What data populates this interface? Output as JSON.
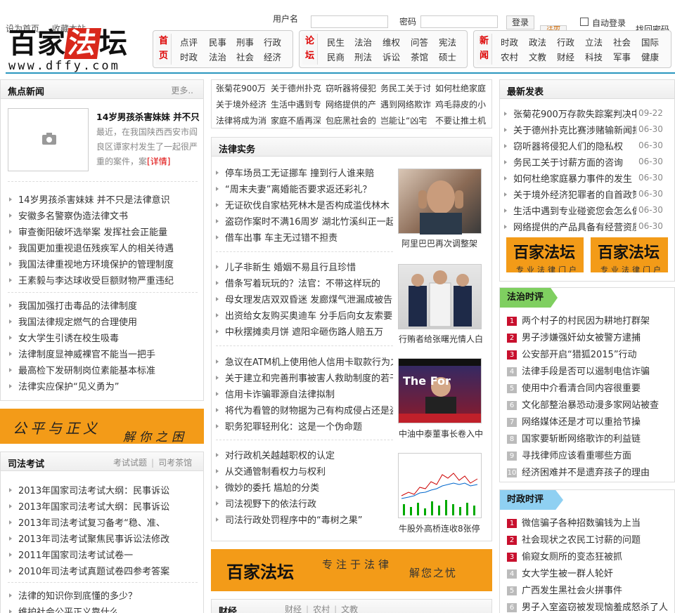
{
  "header": {
    "top_links": [
      "设为首页",
      "收藏本站"
    ],
    "login": {
      "username_label": "用户名",
      "password_label": "密码",
      "login_button": "登录",
      "register_button": "注册",
      "auto_login": "自动登录",
      "forgot_password": "找回密码"
    },
    "logo": {
      "text_a": "百家",
      "text_b": "法",
      "text_c": "坛",
      "url": "www.dffy.com"
    },
    "nav_groups": [
      {
        "head": [
          "首",
          "页"
        ],
        "items": [
          "点评",
          "民事",
          "刑事",
          "行政",
          "时政",
          "法治",
          "社会",
          "经济"
        ]
      },
      {
        "head": [
          "论",
          "坛"
        ],
        "items": [
          "民生",
          "法治",
          "维权",
          "问答",
          "宪法",
          "民商",
          "刑法",
          "诉讼",
          "茶馆",
          "硕士"
        ]
      },
      {
        "head": [
          "新",
          "闻"
        ],
        "items": [
          "时政",
          "政法",
          "行政",
          "立法",
          "社会",
          "国际",
          "农村",
          "文教",
          "财经",
          "科技",
          "军事",
          "健康"
        ]
      }
    ]
  },
  "focus_news": {
    "title": "焦点新闻",
    "more": "更多..",
    "feature": {
      "headline": "14岁男孩杀害妹妹 并不只",
      "summary": "最近，在我国陕西西安市阎良区谭家村发生了一起很严重的案件，案",
      "detail": "[详情]"
    },
    "group1": [
      "14岁男孩杀害妹妹 并不只是法律意识",
      "安徽多名警察伪造法律文书",
      "审查衡阳破坏选举案 发挥社会正能量",
      "我国更加重视退伍残疾军人的相关待遇",
      "我国法律重视地方环境保护的管理制度",
      "王素毅与李达球收受巨额财物严重违纪"
    ],
    "group2": [
      "我国加强打击毒品的法律制度",
      "我国法律规定燃气的合理使用",
      "女大学生引诱在校生吸毒",
      "法律制度显神威裸官不能当一把手",
      "最高检下发研制岗位素能基本标准",
      "法律实应保护“见义勇为”"
    ]
  },
  "banner_left": {
    "text_a": "公平与正义",
    "text_b": "解你之困"
  },
  "judicial_exam": {
    "title": "司法考试",
    "tabs": [
      "考试试题",
      "司考茶馆"
    ],
    "items": [
      "2013年国家司法考试大纲：民事诉讼",
      "2013年国家司法考试大纲：民事诉讼",
      "2013年司法考试复习备考“稳、准、",
      "2013年司法考试聚焦民事诉讼法修改",
      "2011年国家司法考试试卷一",
      "2010年司法考试真题试卷四参考答案"
    ],
    "items2": [
      "法律的知识你到底懂的多少？",
      "维护社会公平正义靠什么"
    ]
  },
  "top_links_block": [
    "张菊花900万",
    "关于德州扑克",
    "窃听器将侵犯",
    "务民工关于讨",
    "如何杜绝家庭",
    "关于境外经济",
    "生活中遇到专",
    "网络提供的产",
    "遇到网络欺诈",
    "鸡毛蒜皮的小",
    "法律将成为消",
    "家庭不盾再深",
    "包庇黑社会的",
    "岂能让“凶宅",
    "不要让推土机"
  ],
  "legal_practice": {
    "title": "法律实务",
    "groups": [
      {
        "items": [
          "停车场员工无证挪车   撞到行人谁来赔",
          "“周末夫妻”离婚能否要求返还彩礼？",
          "无证砍伐自家枯死林木是否构成滥伐林木",
          "盗窃作案时不满16周岁   湖北竹溪纠正一起",
          "借车出事   车主无过错不担责"
        ],
        "caption": "阿里巴巴再次调整架"
      },
      {
        "items": [
          "儿子非新生   婚姻不易且行且珍惜",
          "借条写着玩玩的？法官：不带这样玩的",
          "母女理发店双双昏迷   发廊煤气泄漏成被告",
          "出资给女友购买奥迪车   分手后向女友索要",
          "中秋摆摊卖月饼   遮阳伞砸伤路人赔五万"
        ],
        "caption": "行贿者给张曙光情人白"
      },
      {
        "items": [
          "急议在ATM机上使用他人信用卡取款行为之",
          "关于建立和完善刑事被害人救助制度的若干",
          "信用卡诈骗罪源自法律拟制",
          "将代为看管的财物据为己有构成侵占还是盗",
          "职务犯罪轻刑化：这是一个伪命题"
        ],
        "caption": "中油中泰董事长卷入中"
      },
      {
        "items": [
          "对行政机关越越职权的认定",
          "从交通管制看权力与权利",
          "微妙的委托   尴尬的分类",
          "司法视野下的依法行政",
          "司法行政处罚程序中的“毒树之果”"
        ],
        "caption": "牛股外高桥连收8张停"
      }
    ],
    "photo3_text": "The For"
  },
  "banner_mid": {
    "text_a": "百家法坛",
    "text_b": "专注于法律",
    "text_c": "解您之忧"
  },
  "finance": {
    "title": "财经",
    "tabs": [
      "财经",
      "农村",
      "文教"
    ]
  },
  "latest": {
    "title": "最新发表",
    "items": [
      {
        "text": "张菊花900万存款失踪案判决中",
        "date": "09-22"
      },
      {
        "text": "关于德州扑克比赛涉赌输新闻报",
        "date": "06-30"
      },
      {
        "text": "窃听器将侵犯人们的隐私权",
        "date": "06-30"
      },
      {
        "text": "务民工关于讨薪方面的咨询",
        "date": "06-30"
      },
      {
        "text": "如何杜绝家庭暴力事件的发生",
        "date": "06-30"
      },
      {
        "text": "关于境外经济犯罪者的自首政策",
        "date": "06-30"
      },
      {
        "text": "生活中遇到专业碰瓷您会怎么做",
        "date": "06-30"
      },
      {
        "text": "网络提供的产品具备有经营资质",
        "date": "06-30"
      }
    ]
  },
  "ads": [
    {
      "text_a": "百家法坛",
      "text_b": "专业法律门户"
    },
    {
      "text_a": "百家法坛",
      "text_b": "专业法律门户"
    }
  ],
  "legal_comment": {
    "title": "法治时评",
    "items": [
      "两个村子的村民因为耕地打群架",
      "男子涉嫌强奸幼女被警方逮捕",
      "公安部开启“猎狐2015”行动",
      "法律手段是否可以遏制电信诈骗",
      "使用中介看清合同内容很重要",
      "文化部整治暴恐动漫多家网站被查",
      "网络媒体还是才可以重拾节操",
      "国家要斩断网络歌诈的利益链",
      "寻找律师应该看重哪些方面",
      "经济困难并不是遗弃孩子的理由"
    ]
  },
  "politics_comment": {
    "title": "时政时评",
    "items": [
      "微信骗子各种招数骗钱为上当",
      "社会现状之农民工讨薪的问题",
      "偷窥女厕所的变态狂被抓",
      "女大学生被一群人轮奸",
      "广西发生黑社会火拼事件",
      "男子入室盗窃被发现恼羞成怒杀了人"
    ]
  },
  "colors": {
    "accent_blue": "#2a97bf",
    "red": "#d9281c",
    "orange": "#f39b18",
    "green_tab": "#7fcf60",
    "blue_tab": "#8fd0f2"
  }
}
